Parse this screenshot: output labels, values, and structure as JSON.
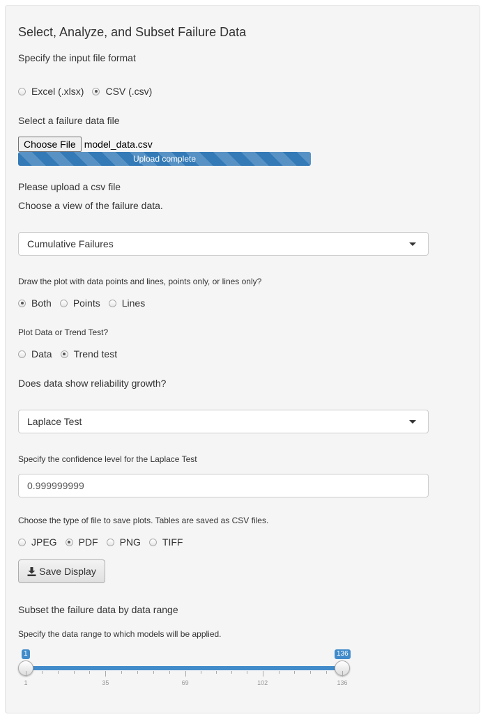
{
  "panel": {
    "title": "Select, Analyze, and Subset Failure Data"
  },
  "file_format": {
    "label": "Specify the input file format",
    "options": [
      {
        "label": "Excel (.xlsx)",
        "checked": false
      },
      {
        "label": "CSV (.csv)",
        "checked": true
      }
    ]
  },
  "file_upload": {
    "label": "Select a failure data file",
    "button_label": "Choose File",
    "file_name": "model_data.csv",
    "progress_text": "Upload complete",
    "progress": 1.0
  },
  "messages": {
    "upload_hint": "Please upload a csv file",
    "view_label": "Choose a view of the failure data."
  },
  "view_select": {
    "selected": "Cumulative Failures"
  },
  "plot_style": {
    "label": "Draw the plot with data points and lines, points only, or lines only?",
    "options": [
      {
        "label": "Both",
        "checked": true
      },
      {
        "label": "Points",
        "checked": false
      },
      {
        "label": "Lines",
        "checked": false
      }
    ]
  },
  "plot_type": {
    "label": "Plot Data or Trend Test?",
    "options": [
      {
        "label": "Data",
        "checked": false
      },
      {
        "label": "Trend test",
        "checked": true
      }
    ]
  },
  "growth": {
    "label": "Does data show reliability growth?",
    "selected": "Laplace Test"
  },
  "confidence": {
    "label": "Specify the confidence level for the Laplace Test",
    "value": "0.999999999"
  },
  "save_format": {
    "label": "Choose the type of file to save plots. Tables are saved as CSV files.",
    "options": [
      {
        "label": "JPEG",
        "checked": false
      },
      {
        "label": "PDF",
        "checked": true
      },
      {
        "label": "PNG",
        "checked": false
      },
      {
        "label": "TIFF",
        "checked": false
      }
    ],
    "button_label": "Save Display",
    "button_icon": "download-icon"
  },
  "subset": {
    "title": "Subset the failure data by data range",
    "label": "Specify the data range to which models will be applied.",
    "min": 1,
    "max": 136,
    "from": 1,
    "to": 136,
    "from_label": "1",
    "to_label": "136",
    "tick_labels": [
      "1",
      "35",
      "69",
      "102",
      "136"
    ]
  },
  "colors": {
    "accent": "#428bca",
    "progress": "#337ab7",
    "panel_bg": "#f5f5f5"
  }
}
